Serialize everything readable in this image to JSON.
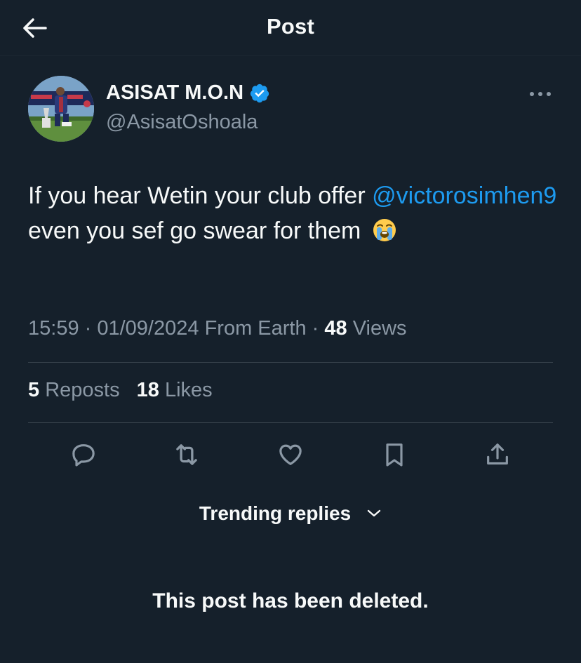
{
  "header": {
    "title": "Post",
    "back_icon": "arrow-left-icon"
  },
  "author": {
    "display_name": "ASISAT M.O.N",
    "handle": "@AsisatOshoala",
    "verified": true,
    "verified_color": "#1d9bf0"
  },
  "post": {
    "text_part1": "If you hear Wetin your club offer ",
    "mention": "@victorosimhen9",
    "text_part2": " even you sef go swear for them ",
    "emoji": "loudly-crying-face"
  },
  "meta": {
    "time": "15:59",
    "date": "01/09/2024",
    "source": "From Earth",
    "views_count": "48",
    "views_label": "Views"
  },
  "stats": {
    "reposts_count": "5",
    "reposts_label": "Reposts",
    "likes_count": "18",
    "likes_label": "Likes"
  },
  "actions": [
    "reply-icon",
    "repost-icon",
    "like-icon",
    "bookmark-icon",
    "share-icon"
  ],
  "replies": {
    "sort_label": "Trending replies",
    "deleted_notice": "This post has been deleted."
  },
  "colors": {
    "background": "#15202b",
    "text": "#f7f9f9",
    "secondary_text": "#8b98a5",
    "accent": "#1d9bf0",
    "divider": "#38444d"
  }
}
